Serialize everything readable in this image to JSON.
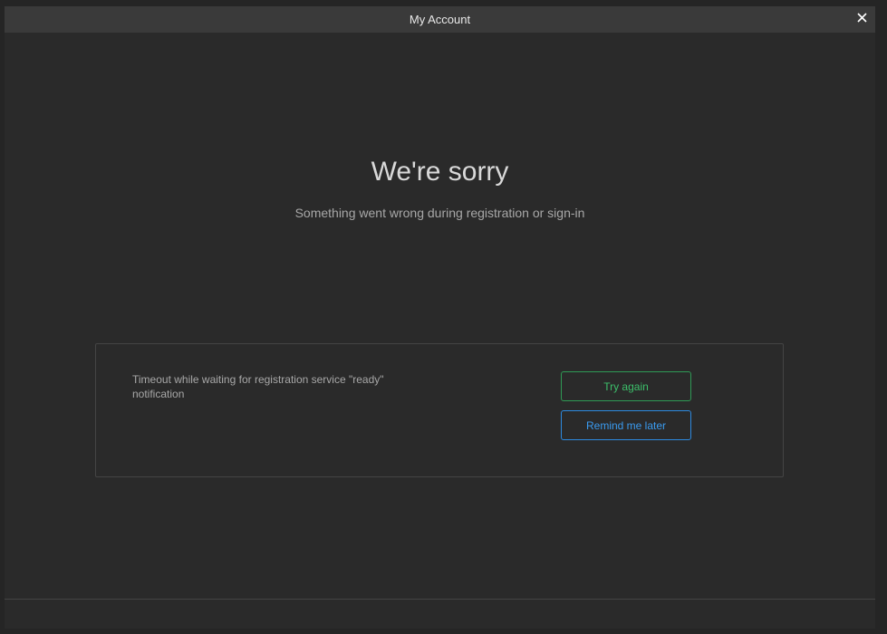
{
  "window": {
    "title": "My Account",
    "close_icon": "close-icon"
  },
  "main": {
    "heading": "We're sorry",
    "subheading": "Something went wrong during registration or sign-in"
  },
  "panel": {
    "message": "Timeout while waiting for registration service \"ready\" notification",
    "try_again_label": "Try again",
    "remind_later_label": "Remind me later"
  },
  "colors": {
    "background": "#2a2a2a",
    "titlebar": "#3a3a3a",
    "accent_green": "#3cbf6a",
    "accent_blue": "#3a9bf0"
  }
}
